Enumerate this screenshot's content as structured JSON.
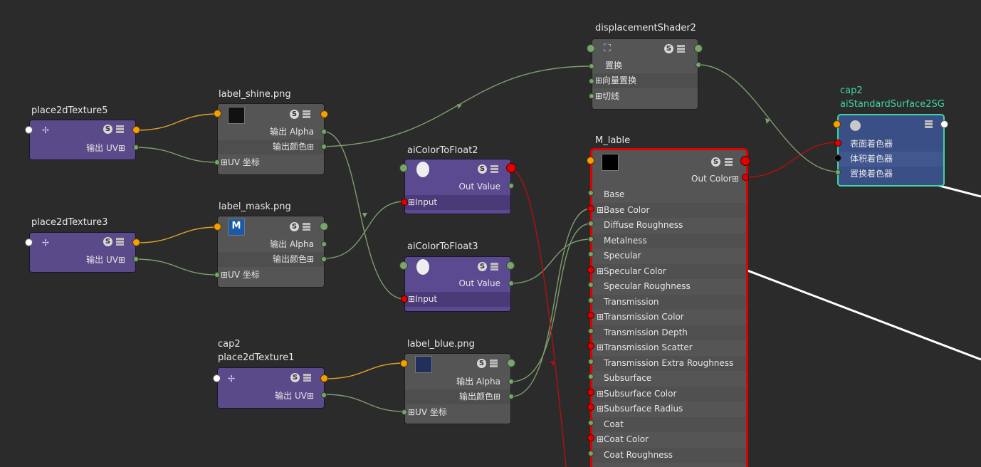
{
  "icons": {
    "s_icon": "S",
    "stack_icon": "stack",
    "texture_icon": "✢",
    "table_prefix": "⊞",
    "mask_swatch_letter": "M"
  },
  "nodes": {
    "place5": {
      "title": "place2dTexture5",
      "out": "输出 UV⊞"
    },
    "place3": {
      "title": "place2dTexture3",
      "out": "输出 UV⊞"
    },
    "place1": {
      "title_line1": "cap2",
      "title_line2": "place2dTexture1",
      "out": "输出 UV⊞"
    },
    "shine": {
      "title": "label_shine.png",
      "alpha": "输出 Alpha",
      "color": "输出颜色⊞",
      "uv": "⊞UV 坐标"
    },
    "mask": {
      "title": "label_mask.png",
      "alpha": "输出 Alpha",
      "color": "输出颜色⊞",
      "uv": "⊞UV 坐标"
    },
    "blue": {
      "title": "label_blue.png",
      "alpha": "输出 Alpha",
      "color": "输出颜色⊞",
      "uv": "⊞UV 坐标"
    },
    "ctf2": {
      "title": "aiColorToFloat2",
      "out": "Out Value",
      "input": "⊞Input"
    },
    "ctf3": {
      "title": "aiColorToFloat3",
      "out": "Out Value",
      "input": "⊞Input"
    },
    "disp": {
      "title": "displacementShader2",
      "rows": [
        "置换",
        "⊞向量置换",
        "⊞切线"
      ]
    },
    "mat": {
      "title": "M_lable",
      "out": "Out Color⊞",
      "rows": [
        "Base",
        "⊞Base Color",
        "Diffuse Roughness",
        "Metalness",
        "Specular",
        "⊞Specular Color",
        "Specular Roughness",
        "Transmission",
        "⊞Transmission Color",
        "Transmission Depth",
        "⊞Transmission Scatter",
        "Transmission Extra Roughness",
        "Subsurface",
        "⊞Subsurface Color",
        "⊞Subsurface Radius",
        "Coat",
        "⊞Coat Color",
        "Coat Roughness"
      ]
    },
    "sg": {
      "title_line1": "cap2",
      "title_line2": "aiStandardSurface2SG",
      "rows": [
        "表面着色器",
        "体积着色器",
        "置换着色器"
      ]
    }
  },
  "colors": {
    "background": "#2b2b2b",
    "place_node": "#4a3a78",
    "conv_node": "#5c4a90",
    "file_node": "#555555",
    "material_border": "#e00000",
    "sg_node": "#3a4f86",
    "sg_border": "#3fd6a0",
    "wire_green": "#7e9c6e",
    "wire_orange": "#e2a12a",
    "wire_red": "#b21010"
  }
}
